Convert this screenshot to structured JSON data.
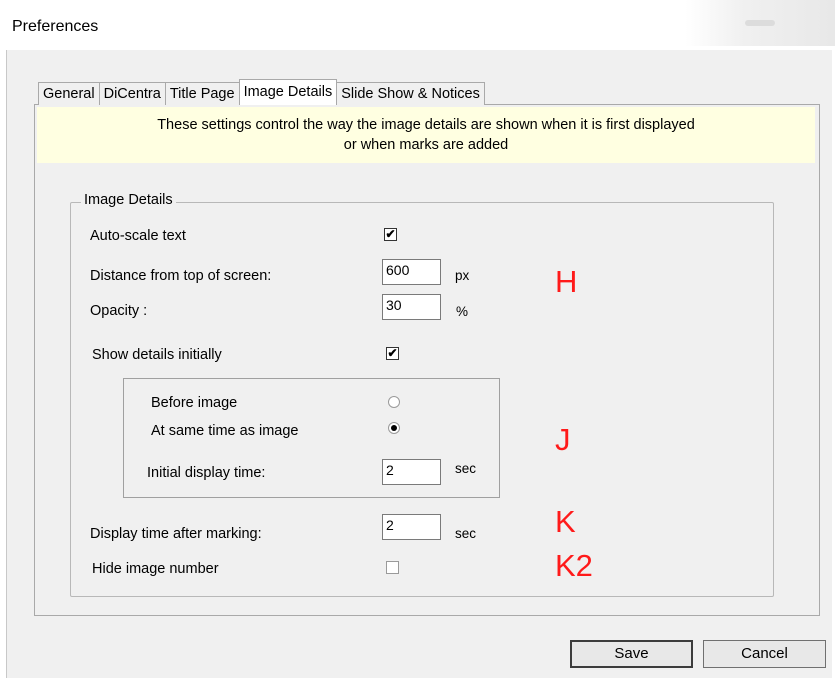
{
  "window": {
    "title": "Preferences"
  },
  "tabs": [
    {
      "label": "General",
      "active": false
    },
    {
      "label": "DiCentra",
      "active": false
    },
    {
      "label": "Title Page",
      "active": false
    },
    {
      "label": "Image Details",
      "active": true
    },
    {
      "label": "Slide Show & Notices",
      "active": false
    }
  ],
  "banner": {
    "line1": "These settings control the way the image details are shown when it is first displayed",
    "line2": "or when marks are added"
  },
  "group": {
    "label": "Image Details",
    "auto_scale": {
      "label": "Auto-scale text",
      "checked": true
    },
    "distance": {
      "label": "Distance from top of screen:",
      "value": "600",
      "unit": "px"
    },
    "opacity": {
      "label": "Opacity :",
      "value": "30",
      "unit": "%"
    },
    "show_details": {
      "label": "Show details initially",
      "checked": true
    },
    "before_image": {
      "label": "Before image",
      "selected": false
    },
    "same_time": {
      "label": "At same time as image",
      "selected": true
    },
    "initial_time": {
      "label": "Initial display time:",
      "value": "2",
      "unit": "sec"
    },
    "after_marking": {
      "label": "Display time after marking:",
      "value": "2",
      "unit": "sec"
    },
    "hide_number": {
      "label": "Hide image number",
      "checked": false
    }
  },
  "annotations": {
    "h": "H",
    "j": "J",
    "k": "K",
    "k2": "K2",
    "color": "#ff1a1a"
  },
  "buttons": {
    "save": "Save",
    "cancel": "Cancel"
  },
  "icons": {
    "check": "✔"
  }
}
